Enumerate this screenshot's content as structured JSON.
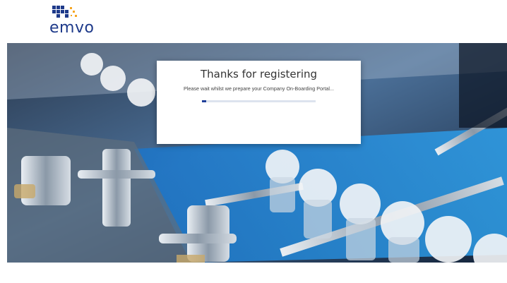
{
  "logo": {
    "icon": "emvo-logo-icon",
    "text": "emvo",
    "colors": {
      "primary": "#1e3a8a",
      "accent": "#f5a623"
    }
  },
  "hero": {
    "icon": "production-line-photo"
  },
  "modal": {
    "title": "Thanks for registering",
    "subtitle": "Please wait whilst we prepare your Company On-Boarding Portal...",
    "progress": 0.04
  },
  "colors": {
    "progress_fill": "#1f3f99",
    "progress_track": "#dde3ee"
  }
}
